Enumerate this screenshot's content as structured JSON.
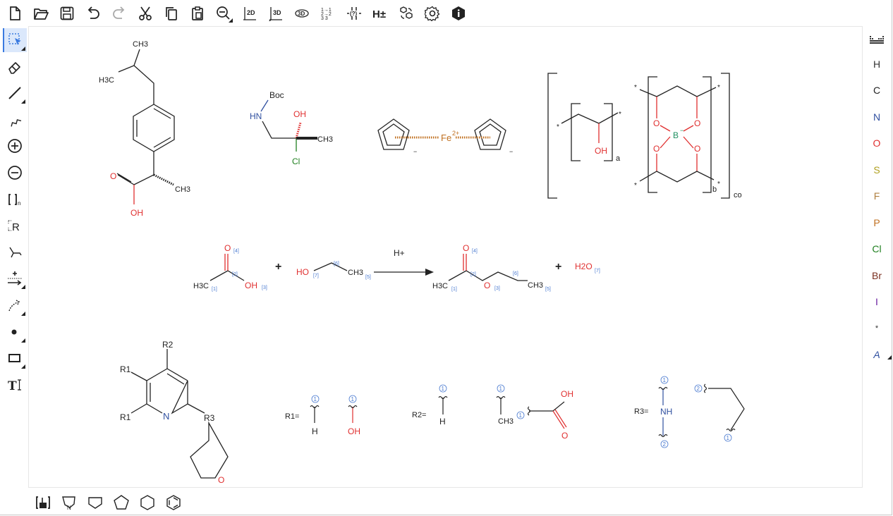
{
  "colors": {
    "carbon": "#222222",
    "oxygen": "#e03030",
    "nitrogen": "#3050a0",
    "chlorine": "#208020",
    "sulfur": "#b0a020",
    "phosphorus": "#c07020",
    "fluorine": "#b08040",
    "iron": "#c07020",
    "boron": "#209060",
    "mapping": "#4a7ad0",
    "accent": "#3a7ae0"
  },
  "top_toolbar": {
    "icons": [
      "new-file-icon",
      "open-folder-icon",
      "save-icon",
      "undo-icon",
      "redo-icon",
      "cut-icon",
      "copy-icon",
      "paste-icon",
      "zoom-icon",
      "clean-2d-icon",
      "clean-3d-icon",
      "3d-view-icon",
      "aromatize-icon",
      "check-structure-icon",
      "add-hydrogens-icon",
      "calculate-icon",
      "settings-icon",
      "info-icon"
    ],
    "labels": {
      "clean2d": "2D",
      "clean3d": "3D",
      "view3d": "3D",
      "hplus": "H±",
      "check": "(?)"
    }
  },
  "left_toolbar": {
    "items": [
      "selection-tool",
      "eraser-tool",
      "single-bond-tool",
      "chain-tool",
      "charge-plus-tool",
      "charge-minus-tool",
      "sgroup-tool",
      "rgroup-tool",
      "reaction-map-tool",
      "arrow-tool",
      "reaction-plus-tool",
      "atom-tool",
      "shape-tool",
      "text-tool"
    ],
    "labels": {
      "sgroup": "[]n",
      "rgroup": "R"
    }
  },
  "right_toolbar": {
    "elements": [
      {
        "symbol": "H",
        "color": "#333333"
      },
      {
        "symbol": "C",
        "color": "#222222"
      },
      {
        "symbol": "N",
        "color": "#3050a0"
      },
      {
        "symbol": "O",
        "color": "#e03030"
      },
      {
        "symbol": "S",
        "color": "#b0a020"
      },
      {
        "symbol": "F",
        "color": "#b08040"
      },
      {
        "symbol": "P",
        "color": "#c07020"
      },
      {
        "symbol": "Cl",
        "color": "#208020"
      },
      {
        "symbol": "Br",
        "color": "#7a3020"
      },
      {
        "symbol": "I",
        "color": "#6a20a0"
      },
      {
        "symbol": "*",
        "color": "#333333"
      },
      {
        "symbol": "A",
        "color": "#3050a0"
      }
    ]
  },
  "bottom_toolbar": {
    "templates": [
      "template-library-icon",
      "pyranose-template-icon",
      "cyclopentane-icon",
      "cyclopentane-flat-icon",
      "cyclohexane-icon",
      "benzene-icon"
    ]
  },
  "canvas": {
    "ibuprofen": {
      "ch3_top": "CH3",
      "h3c": "H3C",
      "o": "O",
      "oh": "OH",
      "ch3": "CH3"
    },
    "boc_mol": {
      "boc": "Boc",
      "hn": "HN",
      "oh": "OH",
      "ch3": "CH3",
      "cl": "Cl"
    },
    "ferrocene": {
      "fe": "Fe",
      "charge": "2+",
      "minus": "−"
    },
    "polymer": {
      "star": "*",
      "a": "a",
      "b": "b",
      "co": "co",
      "oh": "OH",
      "o": "O",
      "b_atom": "B",
      "b_charge": "−"
    },
    "reaction": {
      "plus": "+",
      "catalyst": "H+",
      "acetic_o": "O",
      "acetic_oh": "OH",
      "acetic_h3c": "H3C",
      "ethanol_ho": "HO",
      "ethanol_ch3": "CH3",
      "ester_o": "O",
      "ester_h3c": "H3C",
      "ester_ch3": "CH3",
      "water": "H2O",
      "maps": [
        "[4]",
        "[2]",
        "[1]",
        "[3]",
        "[7]",
        "[6]",
        "[5]"
      ]
    },
    "pyridine": {
      "r2": "R2",
      "r1a": "R1",
      "r1b": "R1",
      "n": "N",
      "r3": "R3",
      "o": "O"
    },
    "rgroups": {
      "r1_label": "R1=",
      "r1_h": "H",
      "r1_oh": "OH",
      "r2_label": "R2=",
      "r2_h": "H",
      "r2_ch3": "CH3",
      "r2_oh": "OH",
      "r2_o": "O",
      "r3_label": "R3=",
      "r3_nh": "NH",
      "attach1": "1",
      "attach2": "2"
    }
  }
}
